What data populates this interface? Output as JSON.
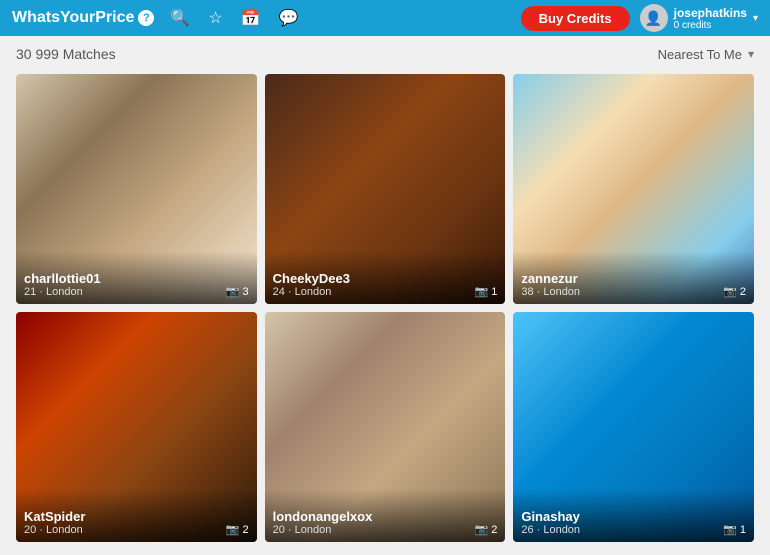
{
  "header": {
    "logo_text": "WhatsYourPrice",
    "buy_credits_label": "Buy Credits",
    "user": {
      "name": "josephatkins",
      "credits_text": "0 credits"
    }
  },
  "toolbar": {
    "matches_text": "30 999 Matches",
    "sort_label": "Nearest To Me"
  },
  "cards": [
    {
      "id": 1,
      "name": "charllottie01",
      "age": "21",
      "location": "London",
      "photo_count": "3",
      "photo_class": "photo-1"
    },
    {
      "id": 2,
      "name": "CheekyDee3",
      "age": "24",
      "location": "London",
      "photo_count": "1",
      "photo_class": "photo-2"
    },
    {
      "id": 3,
      "name": "zannezur",
      "age": "38",
      "location": "London",
      "photo_count": "2",
      "photo_class": "photo-3"
    },
    {
      "id": 4,
      "name": "KatSpider",
      "age": "20",
      "location": "London",
      "photo_count": "2",
      "photo_class": "photo-4"
    },
    {
      "id": 5,
      "name": "londonangelxox",
      "age": "20",
      "location": "London",
      "photo_count": "2",
      "photo_class": "photo-5"
    },
    {
      "id": 6,
      "name": "Ginashay",
      "age": "26",
      "location": "London",
      "photo_count": "1",
      "photo_class": "photo-6"
    }
  ],
  "icons": {
    "search": "🔍",
    "star": "☆",
    "calendar": "📅",
    "chat": "💬",
    "camera": "📷",
    "chevron_down": "▾"
  }
}
